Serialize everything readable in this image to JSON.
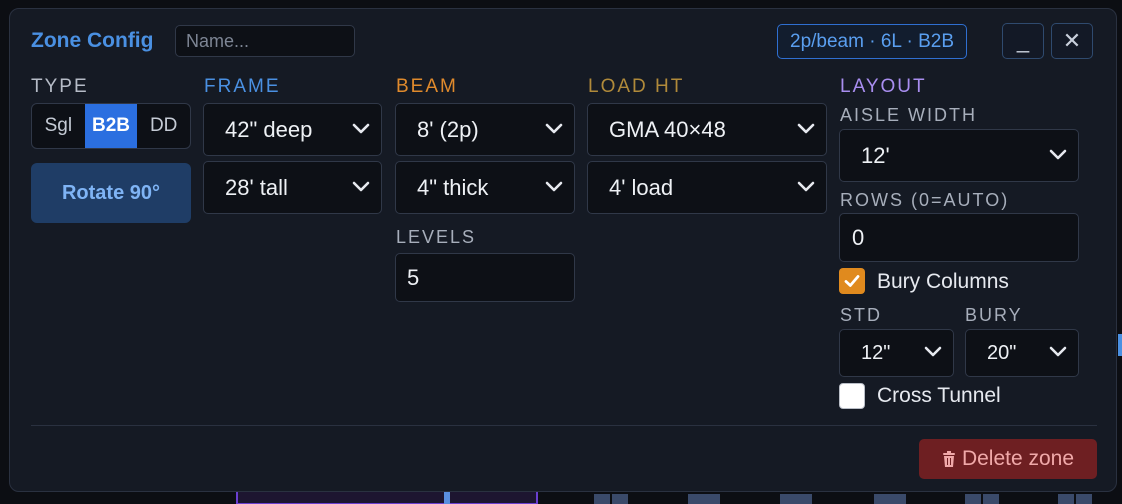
{
  "header": {
    "title": "Zone Config",
    "name_placeholder": "Name...",
    "summary": "2p/beam · 6L · B2B",
    "minimize_label": "_",
    "close_label": "✕"
  },
  "type": {
    "label": "TYPE",
    "options": [
      "Sgl",
      "B2B",
      "DD"
    ],
    "selected": "B2B",
    "rotate_label": "Rotate 90°"
  },
  "frame": {
    "label": "FRAME",
    "depth": "42\" deep",
    "height": "28' tall"
  },
  "beam": {
    "label": "BEAM",
    "length": "8' (2p)",
    "thickness": "4\" thick",
    "levels_label": "LEVELS",
    "levels_value": "5"
  },
  "load_ht": {
    "label": "LOAD HT",
    "pallet": "GMA 40×48",
    "load": "4' load"
  },
  "layout": {
    "label": "LAYOUT",
    "aisle_width_label": "AISLE WIDTH",
    "aisle_width": "12'",
    "rows_label": "ROWS (0=AUTO)",
    "rows_value": "0",
    "bury_columns_label": "Bury Columns",
    "bury_columns_checked": true,
    "std_label": "STD",
    "std_value": "12\"",
    "bury_label": "BURY",
    "bury_value": "20\"",
    "cross_tunnel_label": "Cross Tunnel",
    "cross_tunnel_checked": false
  },
  "footer": {
    "delete_label": "Delete zone"
  },
  "colors": {
    "accent_blue": "#4a90e2",
    "beam_orange": "#e08a2c",
    "layout_purple": "#a98ef0",
    "delete_red": "#6e1f22"
  }
}
